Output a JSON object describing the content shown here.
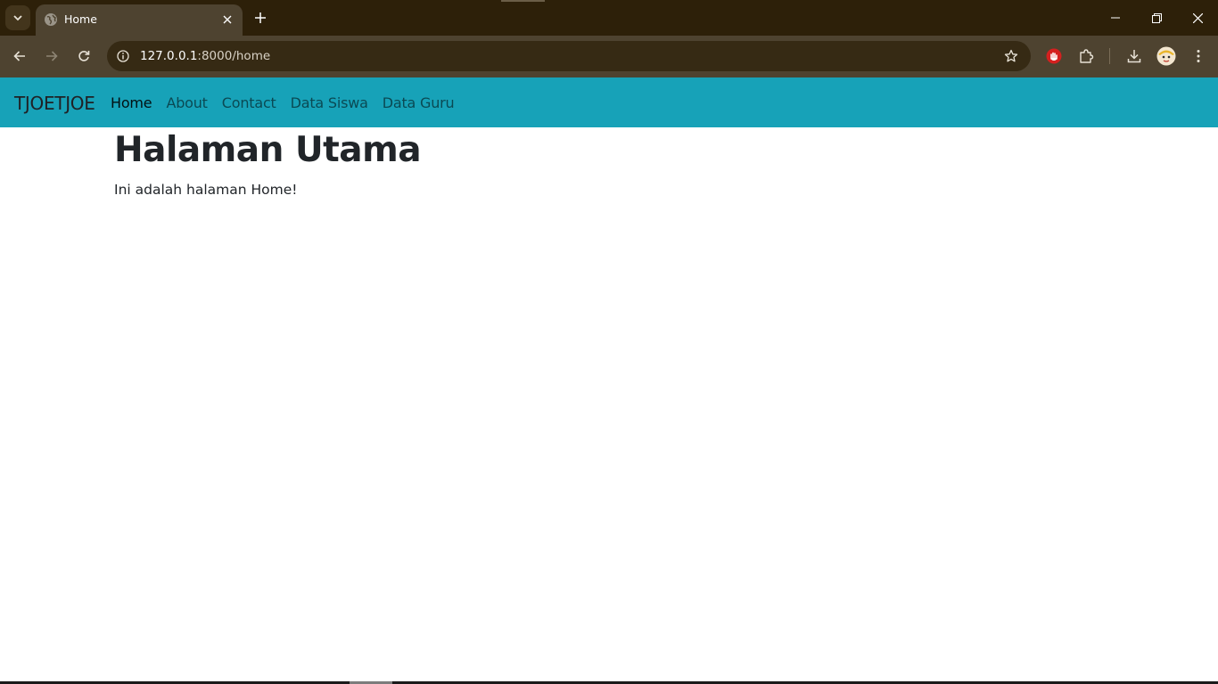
{
  "browser": {
    "tab": {
      "title": "Home"
    },
    "omnibox": {
      "url_host": "127.0.0.1",
      "url_rest": ":8000/home"
    },
    "colors": {
      "tabstrip": "#2d2009",
      "toolbar": "#4e4330",
      "omnibox": "#362a14"
    },
    "icons": [
      "tab-search-icon",
      "globe-icon",
      "close-icon",
      "plus-icon",
      "minimize-icon",
      "restore-icon",
      "window-close-icon",
      "back-arrow-icon",
      "forward-arrow-icon",
      "reload-icon",
      "info-icon",
      "star-icon",
      "red-hand-extension-icon",
      "puzzle-icon",
      "download-icon",
      "avatar-icon",
      "kebab-menu-icon"
    ]
  },
  "navbar": {
    "brand": "TJOETJOE",
    "links": [
      {
        "label": "Home",
        "active": true
      },
      {
        "label": "About",
        "active": false
      },
      {
        "label": "Contact",
        "active": false
      },
      {
        "label": "Data Siswa",
        "active": false
      },
      {
        "label": "Data Guru",
        "active": false
      }
    ],
    "color": "#17a2b8"
  },
  "main": {
    "title": "Halaman Utama",
    "text": "Ini adalah halaman Home!"
  }
}
